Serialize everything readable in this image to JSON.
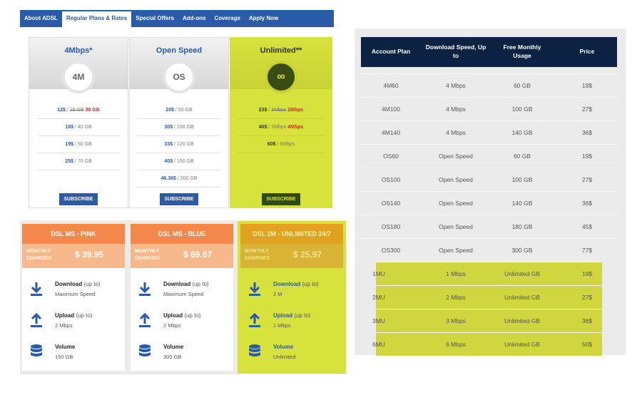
{
  "tabs": [
    "About ADSL",
    "Regular Plans & Rates",
    "Special Offers",
    "Add-ons",
    "Coverage",
    "Apply Now"
  ],
  "plans": [
    {
      "name": "4Mbps*",
      "badge": "4M",
      "rows": [
        {
          "price": "12$",
          "size": "15 GB",
          "extra": "30 GB",
          "strike": true
        },
        {
          "price": "16$",
          "size": "40 GB"
        },
        {
          "price": "19$",
          "size": "50 GB"
        },
        {
          "price": "25$",
          "size": "70 GB"
        }
      ],
      "subscribe": "SUBSCRIBE"
    },
    {
      "name": "Open Speed",
      "badge": "OS",
      "rows": [
        {
          "price": "20$",
          "size": "50 GB"
        },
        {
          "price": "30$",
          "size": "100 GB"
        },
        {
          "price": "33$",
          "size": "120 GB"
        },
        {
          "price": "40$",
          "size": "150 GB"
        },
        {
          "price": "46.36$",
          "size": "200 GB"
        }
      ],
      "subscribe": "SUBSCRIBE"
    },
    {
      "name": "Unlimited**",
      "badge": "∞",
      "rows": [
        {
          "price": "23$",
          "size": "1Mbps",
          "extra": "2Mbps",
          "strike": true
        },
        {
          "price": "40$",
          "size": "2Mbps",
          "extra": "4Mbps"
        },
        {
          "price": "60$",
          "size": "6Mbps"
        }
      ],
      "subscribe": "SUBSCRIBE"
    }
  ],
  "dsl_cards": [
    {
      "title": "DSL MS - PINK",
      "charges_label": "MONTHLY CHARGES",
      "amount": "$ 39.95",
      "features": [
        {
          "icon": "download-icon",
          "title": "Download",
          "suffix": " (up to)",
          "value": "Maximum Speed"
        },
        {
          "icon": "upload-icon",
          "title": "Upload",
          "suffix": " (up to)",
          "value": "2 Mbps"
        },
        {
          "icon": "database-icon",
          "title": "Volume",
          "suffix": "",
          "value": "150 GB"
        }
      ]
    },
    {
      "title": "DSL MS - BLUE",
      "charges_label": "MONTHLY CHARGES",
      "amount": "$ 69.67",
      "features": [
        {
          "icon": "download-icon",
          "title": "Download",
          "suffix": " (up to)",
          "value": "Maximum Speed"
        },
        {
          "icon": "upload-icon",
          "title": "Upload",
          "suffix": " (up to)",
          "value": "2 Mbps"
        },
        {
          "icon": "database-icon",
          "title": "Volume",
          "suffix": "",
          "value": "300 GB"
        }
      ]
    },
    {
      "title": "DSL 2M - UNLIMITED 24/7",
      "charges_label": "MONTHLY CHARGES",
      "amount": "$ 25.97",
      "features": [
        {
          "icon": "download-icon",
          "title": "Download",
          "suffix": " (up to)",
          "value": "2 M"
        },
        {
          "icon": "upload-icon",
          "title": "Upload",
          "suffix": " (up to)",
          "value": "1 Mbps"
        },
        {
          "icon": "database-icon",
          "title": "Volume",
          "suffix": "",
          "value": "Unlimited"
        }
      ]
    }
  ],
  "table": {
    "headers": [
      "Account Plan",
      "Download Speed, Up to",
      "Free Monthly Usage",
      "Price"
    ],
    "rows": [
      [
        "4M60",
        "4 Mbps",
        "60 GB",
        "19$"
      ],
      [
        "4M100",
        "4 Mbps",
        "100 GB",
        "27$"
      ],
      [
        "4M140",
        "4 Mbps",
        "140 GB",
        "36$"
      ],
      [
        "OS60",
        "Open Speed",
        "60 GB",
        "19$"
      ],
      [
        "OS100",
        "Open Speed",
        "100 GB",
        "27$"
      ],
      [
        "OS140",
        "Open Speed",
        "140 GB",
        "36$"
      ],
      [
        "OS180",
        "Open Speed",
        "180 GB",
        "45$"
      ],
      [
        "OS300",
        "Open Speed",
        "300 GB",
        "77$"
      ],
      [
        "1MU",
        "1 Mbps",
        "Unlimited GB",
        "19$"
      ],
      [
        "2MU",
        "2 Mbps",
        "Unlimited GB",
        "27$"
      ],
      [
        "3MU",
        "3 Mbps",
        "Unlimited GB",
        "36$"
      ],
      [
        "6MU",
        "6 Mbps",
        "Unlimited GB",
        "50$"
      ]
    ],
    "highlight_rows_from": 8
  },
  "colors": {
    "tab_bar": "#2a5ba8",
    "highlight": "#d7e23d",
    "table_header": "#0c2242",
    "card_header": "#f2894a",
    "price_red": "#d92b2b"
  }
}
